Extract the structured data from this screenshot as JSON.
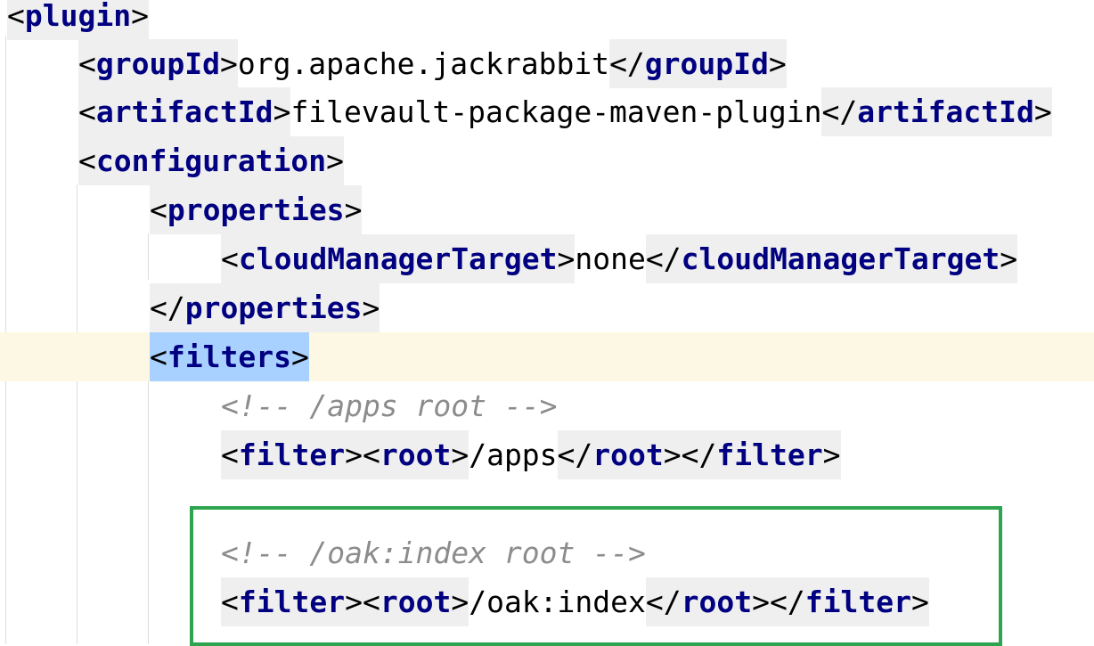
{
  "lines": [
    {
      "open": "<",
      "tag": "plugin",
      "close": ">"
    },
    {
      "open": "<",
      "tag": "groupId",
      "close": ">",
      "text": "org.apache.jackrabbit",
      "end_open": "</",
      "end_tag": "groupId",
      "end_close": ">"
    },
    {
      "open": "<",
      "tag": "artifactId",
      "close": ">",
      "text": "filevault-package-maven-plugin",
      "end_open": "</",
      "end_tag": "artifactId",
      "end_close": ">"
    },
    {
      "open": "<",
      "tag": "configuration",
      "close": ">"
    },
    {
      "open": "<",
      "tag": "properties",
      "close": ">"
    },
    {
      "open": "<",
      "tag": "cloudManagerTarget",
      "close": ">",
      "text": "none",
      "end_open": "</",
      "end_tag": "cloudManagerTarget",
      "end_close": ">"
    },
    {
      "open": "</",
      "tag": "properties",
      "close": ">"
    },
    {
      "open": "<",
      "tag": "filters",
      "close": ">"
    },
    {
      "comment": "<!-- /apps root -->"
    },
    {
      "open": "<",
      "tag": "filter",
      "close": ">",
      "open2": "<",
      "tag2": "root",
      "close2": ">",
      "text": "/apps",
      "end_open": "</",
      "end_tag": "root",
      "end_close": ">",
      "end_open2": "</",
      "end_tag2": "filter",
      "end_close2": ">"
    },
    {},
    {
      "comment": "<!-- /oak:index root -->"
    },
    {
      "open": "<",
      "tag": "filter",
      "close": ">",
      "open2": "<",
      "tag2": "root",
      "close2": ">",
      "text": "/oak:index",
      "end_open": "</",
      "end_tag": "root",
      "end_close": ">",
      "end_open2": "</",
      "end_tag2": "filter",
      "end_close2": ">"
    }
  ],
  "colors": {
    "tag_name": "#000080",
    "comment": "#8c8c8c",
    "caret_row": "#fdf8e4",
    "tag_match": "#efefef",
    "selected_tag": "#a8d1ff",
    "annotation_box": "#2da44e"
  }
}
